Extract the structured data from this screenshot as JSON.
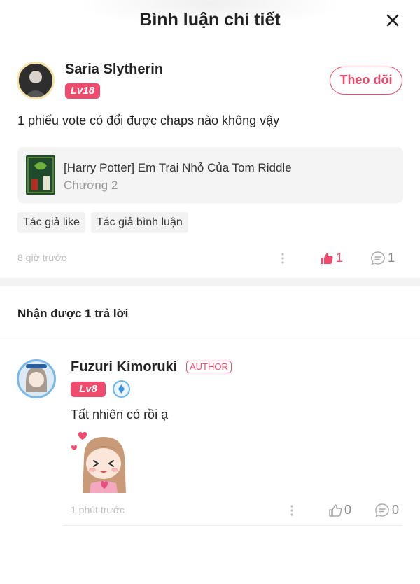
{
  "header": {
    "title": "Bình luận chi tiết",
    "close_icon": "close-icon"
  },
  "comment": {
    "user_name": "Saria Slytherin",
    "level": "Lv18",
    "follow_label": "Theo dõi",
    "text": "1 phiếu vote có đổi được chaps nào không vậy",
    "book": {
      "title": "[Harry Potter] Em Trai Nhỏ Của Tom Riddle",
      "chapter": "Chương 2"
    },
    "tags": [
      "Tác giả like",
      "Tác giả bình luận"
    ],
    "time": "8 giờ trước",
    "likes": "1",
    "replies": "1"
  },
  "replies_heading": "Nhận được 1 trả lời",
  "reply": {
    "user_name": "Fuzuri Kimoruki",
    "author_badge": "AUTHOR",
    "level": "Lv8",
    "text": "Tất nhiên có rồi ạ",
    "time": "1 phút trước",
    "likes": "0",
    "replies": "0"
  },
  "colors": {
    "accent": "#f04a6d",
    "muted": "#bbbbbb",
    "tag_bg": "#f2f2f2"
  }
}
